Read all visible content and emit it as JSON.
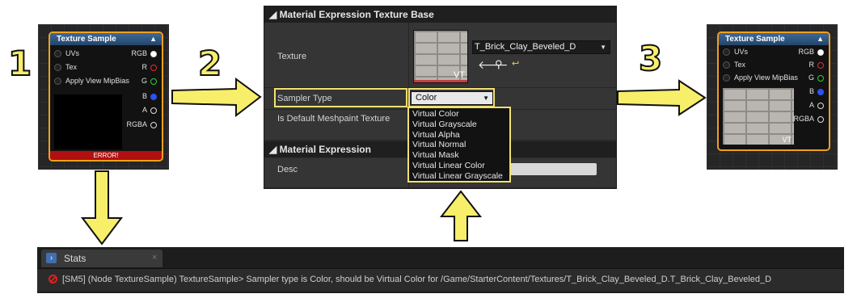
{
  "steps": [
    "1",
    "2",
    "3"
  ],
  "node_left": {
    "title": "Texture Sample",
    "inputs": [
      "UVs",
      "Tex",
      "Apply View MipBias"
    ],
    "outputs": [
      "RGB",
      "R",
      "G",
      "B",
      "A",
      "RGBA"
    ],
    "error": "ERROR!"
  },
  "node_right": {
    "title": "Texture Sample",
    "inputs": [
      "UVs",
      "Tex",
      "Apply View MipBias"
    ],
    "outputs": [
      "RGB",
      "R",
      "G",
      "B",
      "A",
      "RGBA"
    ],
    "vt_badge": "VT"
  },
  "details": {
    "section1": "Material Expression Texture Base",
    "texture_label": "Texture",
    "texture_value": "T_Brick_Clay_Beveled_D",
    "vt_badge": "VT",
    "sampler_label": "Sampler Type",
    "sampler_value": "Color",
    "meshpaint_label": "Is Default Meshpaint Texture",
    "section2": "Material Expression",
    "desc_label": "Desc",
    "sampler_options": [
      "Virtual Color",
      "Virtual Grayscale",
      "Virtual Alpha",
      "Virtual Normal",
      "Virtual Mask",
      "Virtual Linear Color",
      "Virtual Linear Grayscale"
    ]
  },
  "stats": {
    "tab_label": "Stats",
    "message": "[SM5] (Node TextureSample) TextureSample> Sampler type is Color, should be Virtual Color for /Game/StarterContent/Textures/T_Brick_Clay_Beveled_D.T_Brick_Clay_Beveled_D"
  },
  "colors": {
    "accent_yellow": "#f7ee6a",
    "node_border": "#f0a020",
    "error_red": "#b01010"
  }
}
